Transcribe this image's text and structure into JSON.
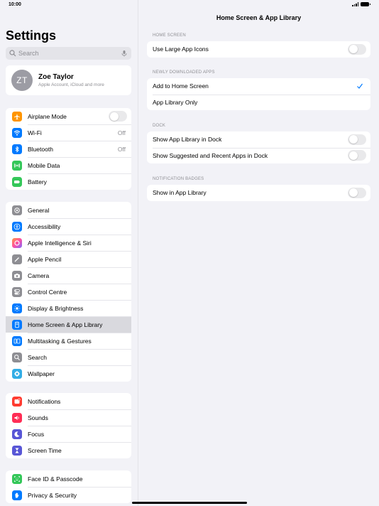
{
  "status": {
    "time": "10:00"
  },
  "sidebar": {
    "title": "Settings",
    "search_placeholder": "Search",
    "profile": {
      "initials": "ZT",
      "name": "Zoe Taylor",
      "subtitle": "Apple Account, iCloud and more"
    },
    "group1": [
      {
        "label": "Airplane Mode",
        "icon": "airplane-icon",
        "color": "#ff9500"
      },
      {
        "label": "Wi-Fi",
        "value": "Off",
        "icon": "wifi-icon",
        "color": "#007aff"
      },
      {
        "label": "Bluetooth",
        "value": "Off",
        "icon": "bluetooth-icon",
        "color": "#007aff"
      },
      {
        "label": "Mobile Data",
        "icon": "antenna-icon",
        "color": "#34c759"
      },
      {
        "label": "Battery",
        "icon": "battery-icon",
        "color": "#34c759"
      }
    ],
    "group2": [
      {
        "label": "General",
        "icon": "gear-icon",
        "color": "#8e8e93"
      },
      {
        "label": "Accessibility",
        "icon": "accessibility-icon",
        "color": "#007aff"
      },
      {
        "label": "Apple Intelligence & Siri",
        "icon": "siri-icon",
        "color": "#ff6b9a"
      },
      {
        "label": "Apple Pencil",
        "icon": "pencil-icon",
        "color": "#8e8e93"
      },
      {
        "label": "Camera",
        "icon": "camera-icon",
        "color": "#8e8e93"
      },
      {
        "label": "Control Centre",
        "icon": "control-centre-icon",
        "color": "#8e8e93"
      },
      {
        "label": "Display & Brightness",
        "icon": "sun-icon",
        "color": "#007aff"
      },
      {
        "label": "Home Screen & App Library",
        "icon": "home-screen-icon",
        "color": "#007aff"
      },
      {
        "label": "Multitasking & Gestures",
        "icon": "multitasking-icon",
        "color": "#007aff"
      },
      {
        "label": "Search",
        "icon": "search-icon",
        "color": "#8e8e93"
      },
      {
        "label": "Wallpaper",
        "icon": "wallpaper-icon",
        "color": "#32ade6"
      }
    ],
    "group3": [
      {
        "label": "Notifications",
        "icon": "bell-icon",
        "color": "#ff3b30"
      },
      {
        "label": "Sounds",
        "icon": "speaker-icon",
        "color": "#ff2d55"
      },
      {
        "label": "Focus",
        "icon": "moon-icon",
        "color": "#5856d6"
      },
      {
        "label": "Screen Time",
        "icon": "hourglass-icon",
        "color": "#5856d6"
      }
    ],
    "group4": [
      {
        "label": "Face ID & Passcode",
        "icon": "face-id-icon",
        "color": "#34c759"
      },
      {
        "label": "Privacy & Security",
        "icon": "hand-icon",
        "color": "#007aff"
      }
    ]
  },
  "main": {
    "title": "Home Screen & App Library",
    "home_screen": {
      "header": "HOME SCREEN",
      "large_icons": "Use Large App Icons"
    },
    "newly_downloaded": {
      "header": "NEWLY DOWNLOADED APPS",
      "add_home": "Add to Home Screen",
      "library_only": "App Library Only"
    },
    "dock": {
      "header": "DOCK",
      "show_library": "Show App Library in Dock",
      "show_suggested": "Show Suggested and Recent Apps in Dock"
    },
    "badges": {
      "header": "NOTIFICATION BADGES",
      "show_in_library": "Show in App Library"
    }
  }
}
